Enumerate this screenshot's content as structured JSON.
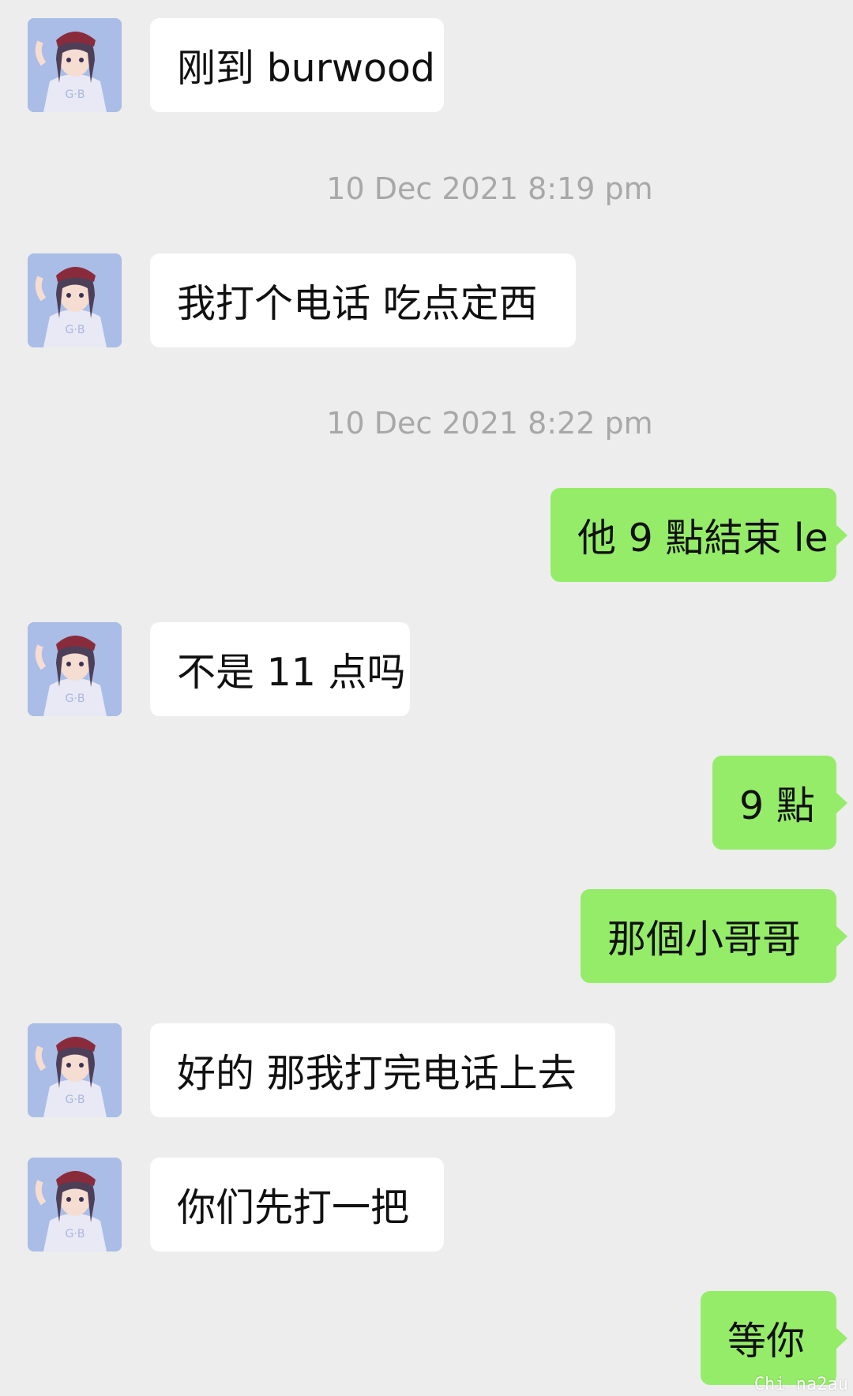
{
  "chat": {
    "timestamps": [
      "10 Dec 2021 8:19 pm",
      "10 Dec 2021 8:22 pm"
    ],
    "messages": [
      {
        "from": "contact",
        "text": "刚到 burwood"
      },
      {
        "from": "contact",
        "text": "我打个电话 吃点定西"
      },
      {
        "from": "self",
        "text": "他 9 點結束 le"
      },
      {
        "from": "contact",
        "text": "不是 11 点吗"
      },
      {
        "from": "self",
        "text": "9 點"
      },
      {
        "from": "self",
        "text": "那個小哥哥"
      },
      {
        "from": "contact",
        "text": "好的 那我打完电话上去"
      },
      {
        "from": "contact",
        "text": "你们先打一把"
      },
      {
        "from": "self",
        "text": "等你"
      }
    ]
  },
  "watermark": "Chi na2au",
  "colors": {
    "background": "#ededed",
    "incoming_bubble": "#ffffff",
    "outgoing_bubble": "#95ec69",
    "timestamp_text": "#a8a8a8"
  },
  "icons": {
    "contact_avatar": "anime-girl-avatar-icon"
  }
}
